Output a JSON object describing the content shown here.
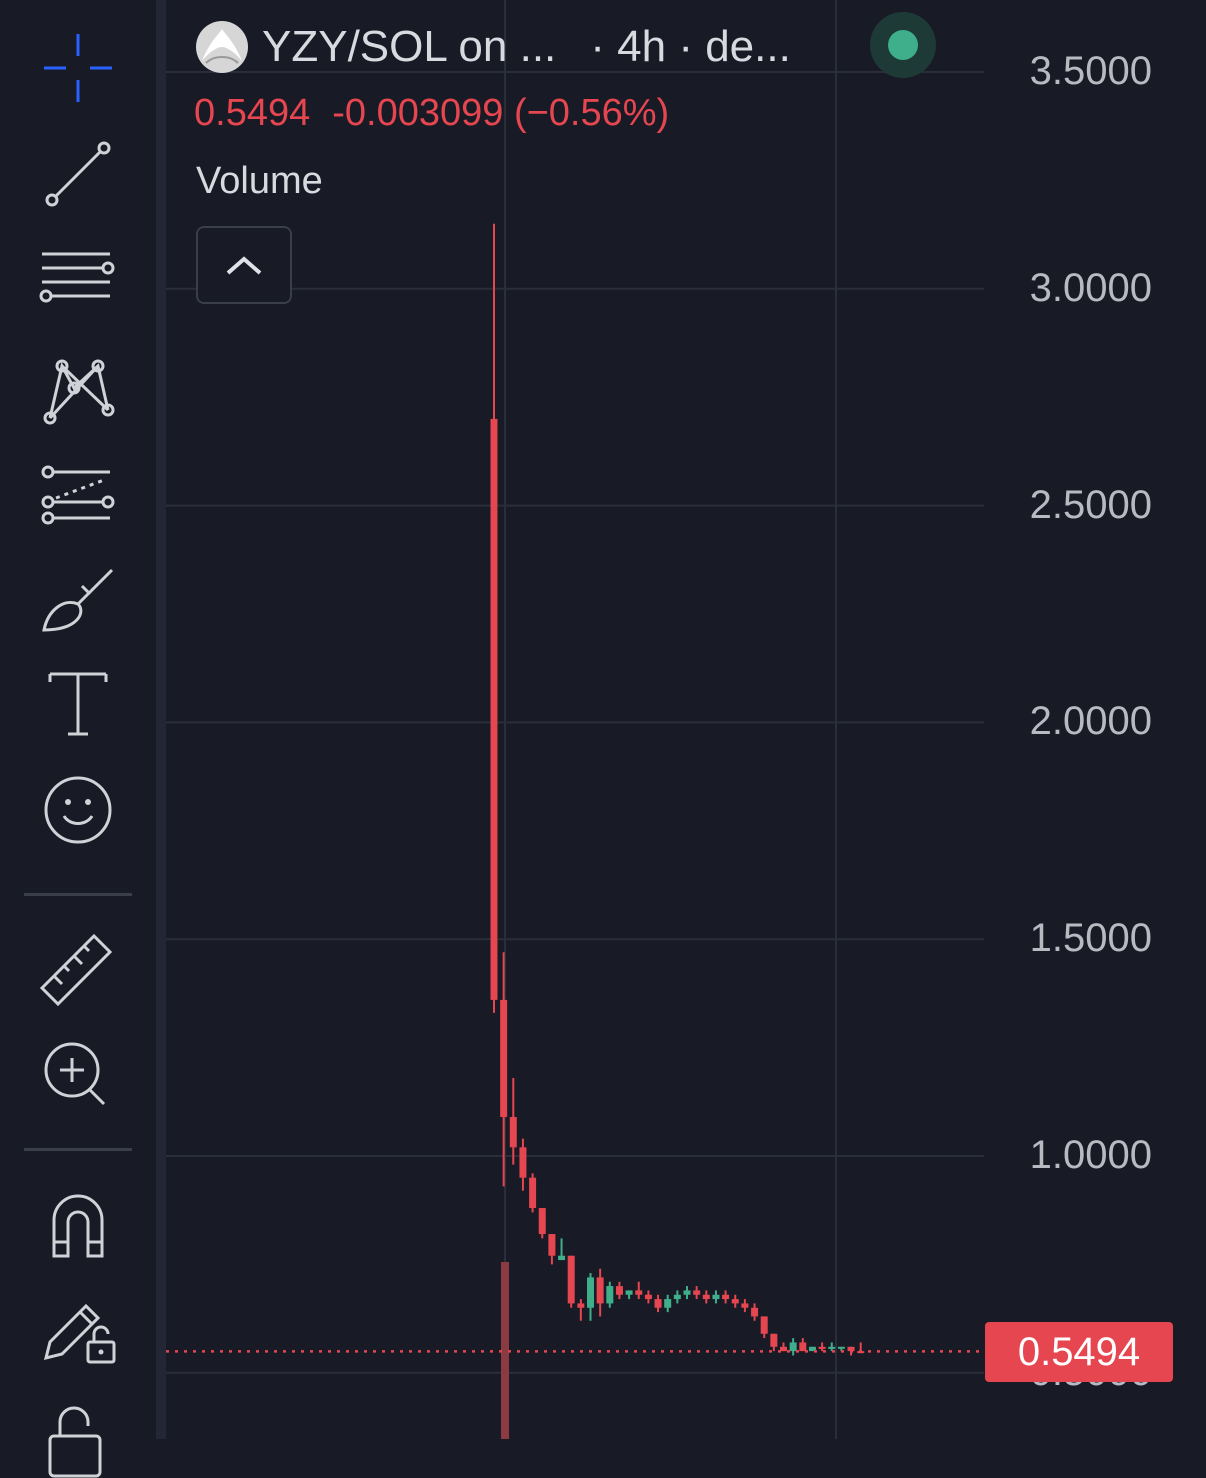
{
  "header": {
    "symbol": "YZY/SOL on ...",
    "interval": "· 4h · de...",
    "last_price": "0.5494",
    "change": "-0.003099 (−0.56%)",
    "volume_label": "Volume"
  },
  "toolbar": {
    "items": [
      "crosshair-icon",
      "trend-line-icon",
      "horizontal-lines-icon",
      "pattern-icon",
      "forecast-icon",
      "brush-icon",
      "text-icon",
      "emoji-icon",
      "ruler-icon",
      "zoom-in-icon",
      "magnet-icon",
      "lock-drawings-icon",
      "unlock-icon"
    ]
  },
  "colors": {
    "up": "#3fae8a",
    "down": "#e5464f",
    "background": "#181a25",
    "grid": "#2a2d3a"
  },
  "chart_data": {
    "type": "candlestick",
    "interval": "4h",
    "ylim": [
      0.45,
      3.6
    ],
    "yticks": [
      "3.5000",
      "3.0000",
      "2.5000",
      "2.0000",
      "1.5000",
      "1.0000",
      "0.5000"
    ],
    "current_price": "0.5494",
    "candles": [
      {
        "o": 2.7,
        "h": 3.15,
        "l": 1.33,
        "c": 1.36
      },
      {
        "o": 1.36,
        "h": 1.47,
        "l": 0.93,
        "c": 1.09
      },
      {
        "o": 1.09,
        "h": 1.18,
        "l": 0.98,
        "c": 1.02
      },
      {
        "o": 1.02,
        "h": 1.04,
        "l": 0.92,
        "c": 0.95
      },
      {
        "o": 0.95,
        "h": 0.96,
        "l": 0.87,
        "c": 0.88
      },
      {
        "o": 0.88,
        "h": 0.88,
        "l": 0.81,
        "c": 0.82
      },
      {
        "o": 0.82,
        "h": 0.82,
        "l": 0.75,
        "c": 0.77
      },
      {
        "o": 0.76,
        "h": 0.76,
        "l": 0.81,
        "c": 0.77
      },
      {
        "o": 0.77,
        "h": 0.77,
        "l": 0.65,
        "c": 0.66
      },
      {
        "o": 0.66,
        "h": 0.67,
        "l": 0.62,
        "c": 0.65
      },
      {
        "o": 0.65,
        "h": 0.73,
        "l": 0.62,
        "c": 0.72
      },
      {
        "o": 0.72,
        "h": 0.74,
        "l": 0.63,
        "c": 0.66
      },
      {
        "o": 0.66,
        "h": 0.71,
        "l": 0.65,
        "c": 0.7
      },
      {
        "o": 0.7,
        "h": 0.71,
        "l": 0.67,
        "c": 0.68
      },
      {
        "o": 0.68,
        "h": 0.69,
        "l": 0.67,
        "c": 0.69
      },
      {
        "o": 0.69,
        "h": 0.71,
        "l": 0.67,
        "c": 0.68
      },
      {
        "o": 0.68,
        "h": 0.69,
        "l": 0.66,
        "c": 0.67
      },
      {
        "o": 0.67,
        "h": 0.68,
        "l": 0.64,
        "c": 0.65
      },
      {
        "o": 0.65,
        "h": 0.68,
        "l": 0.64,
        "c": 0.67
      },
      {
        "o": 0.67,
        "h": 0.69,
        "l": 0.66,
        "c": 0.68
      },
      {
        "o": 0.68,
        "h": 0.7,
        "l": 0.67,
        "c": 0.69
      },
      {
        "o": 0.69,
        "h": 0.7,
        "l": 0.67,
        "c": 0.68
      },
      {
        "o": 0.68,
        "h": 0.69,
        "l": 0.66,
        "c": 0.67
      },
      {
        "o": 0.67,
        "h": 0.69,
        "l": 0.66,
        "c": 0.68
      },
      {
        "o": 0.68,
        "h": 0.69,
        "l": 0.66,
        "c": 0.67
      },
      {
        "o": 0.67,
        "h": 0.68,
        "l": 0.65,
        "c": 0.66
      },
      {
        "o": 0.66,
        "h": 0.67,
        "l": 0.64,
        "c": 0.65
      },
      {
        "o": 0.65,
        "h": 0.66,
        "l": 0.62,
        "c": 0.63
      },
      {
        "o": 0.63,
        "h": 0.63,
        "l": 0.58,
        "c": 0.59
      },
      {
        "o": 0.59,
        "h": 0.59,
        "l": 0.55,
        "c": 0.56
      },
      {
        "o": 0.56,
        "h": 0.57,
        "l": 0.55,
        "c": 0.55
      },
      {
        "o": 0.55,
        "h": 0.58,
        "l": 0.54,
        "c": 0.57
      },
      {
        "o": 0.57,
        "h": 0.58,
        "l": 0.55,
        "c": 0.55
      },
      {
        "o": 0.55,
        "h": 0.56,
        "l": 0.55,
        "c": 0.56
      },
      {
        "o": 0.56,
        "h": 0.57,
        "l": 0.55,
        "c": 0.555
      },
      {
        "o": 0.555,
        "h": 0.57,
        "l": 0.55,
        "c": 0.56
      },
      {
        "o": 0.56,
        "h": 0.56,
        "l": 0.55,
        "c": 0.56
      },
      {
        "o": 0.56,
        "h": 0.56,
        "l": 0.54,
        "c": 0.55
      },
      {
        "o": 0.55,
        "h": 0.57,
        "l": 0.545,
        "c": 0.5494
      }
    ]
  }
}
